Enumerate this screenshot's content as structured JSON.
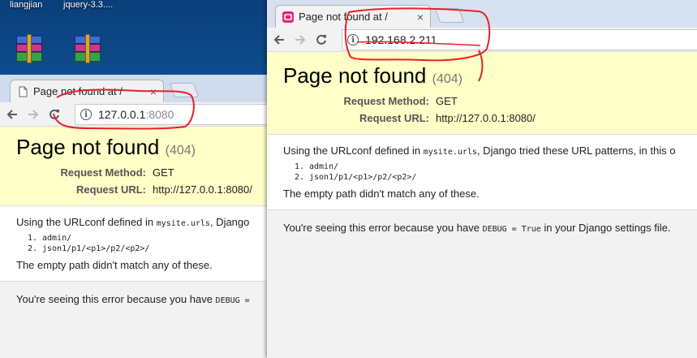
{
  "desktop": {
    "labels": [
      "liangjian",
      "jquery-3.3...."
    ],
    "icons": [
      "winrar-icon",
      "winrar-icon"
    ]
  },
  "colors": {
    "scribble": "#e8202a",
    "summary_bg": "#ffffc8"
  },
  "back_window": {
    "tab_title": "Page not found at /",
    "tab_close": "×",
    "url_host": "127.0.0.1",
    "url_port": ":8080",
    "heading": "Page not found",
    "status_code": "(404)",
    "request_method_label": "Request Method:",
    "request_method": "GET",
    "request_url_label": "Request URL:",
    "request_url": "http://127.0.0.1:8080/",
    "urlconf_prefix": "Using the URLconf defined in ",
    "urlconf_module": "mysite.urls",
    "urlconf_suffix": ", Django",
    "patterns": [
      "admin/",
      "json1/p1/<p1>/p2/<p2>/"
    ],
    "empty_path_msg": "The empty path didn't match any of these.",
    "debug_prefix": "You're seeing this error because you have ",
    "debug_setting": "DEBUG ="
  },
  "front_window": {
    "tab_title": "Page not found at /",
    "tab_close": "×",
    "url_host": "192.168.2.211",
    "heading": "Page not found",
    "status_code": "(404)",
    "request_method_label": "Request Method:",
    "request_method": "GET",
    "request_url_label": "Request URL:",
    "request_url": "http://127.0.0.1:8080/",
    "urlconf_prefix": "Using the URLconf defined in ",
    "urlconf_module": "mysite.urls",
    "urlconf_suffix": ", Django tried these URL patterns, in this o",
    "patterns": [
      "admin/",
      "json1/p1/<p1>/p2/<p2>/"
    ],
    "empty_path_msg": "The empty path didn't match any of these.",
    "debug_prefix": "You're seeing this error because you have ",
    "debug_setting": "DEBUG = True",
    "debug_suffix": " in your Django settings file."
  },
  "nav_icons": [
    "back-arrow-icon",
    "forward-arrow-icon",
    "reload-icon",
    "info-icon"
  ]
}
